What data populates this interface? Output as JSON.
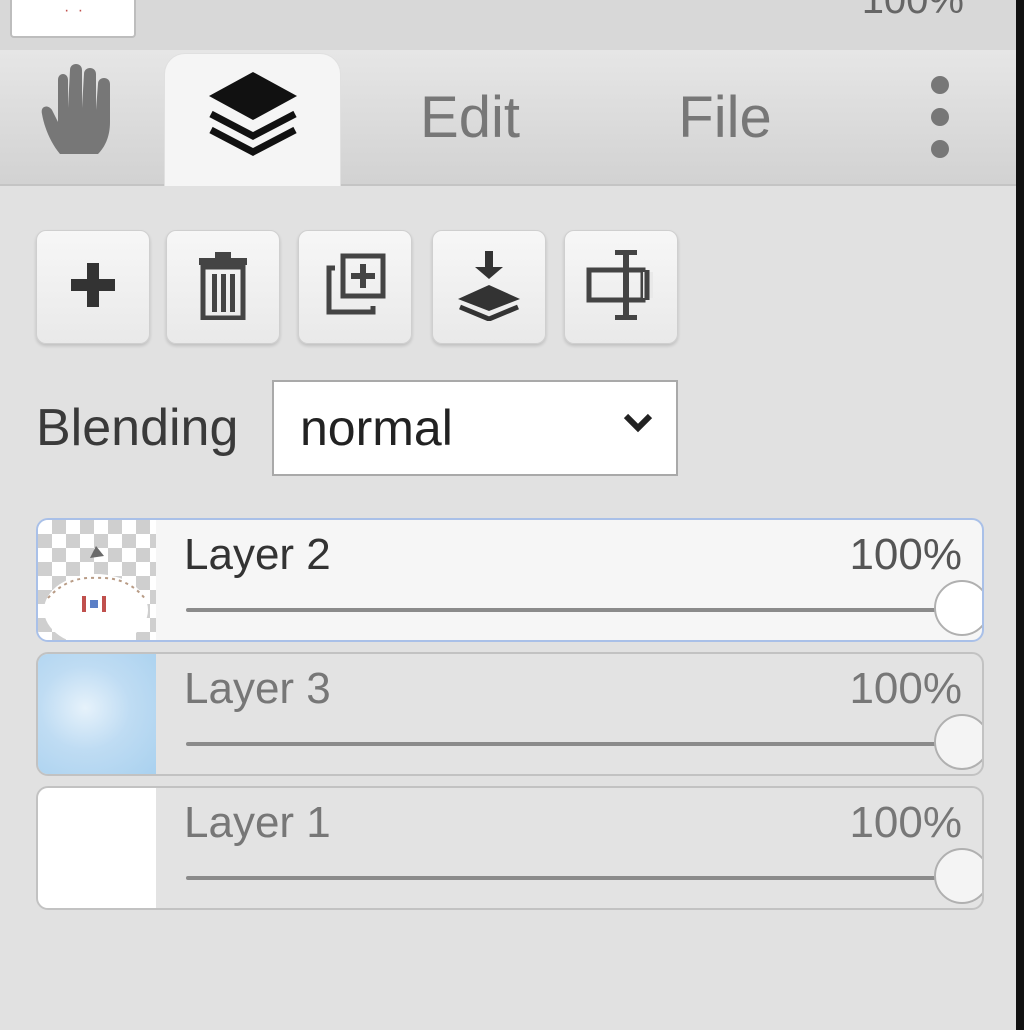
{
  "top": {
    "opacity_partial": "100%"
  },
  "tabs": {
    "hand_icon": "hand-icon",
    "layers_icon": "layers-icon",
    "edit": "Edit",
    "file": "File",
    "more_icon": "more-vertical-icon"
  },
  "toolbar": {
    "buttons": [
      {
        "icon": "add-icon"
      },
      {
        "icon": "trash-icon"
      },
      {
        "icon": "duplicate-icon"
      },
      {
        "icon": "merge-down-icon"
      },
      {
        "icon": "rename-icon"
      }
    ]
  },
  "blending": {
    "label": "Blending",
    "value": "normal"
  },
  "layers": [
    {
      "name": "Layer 2",
      "opacity": "100%",
      "opacity_value": 1.0,
      "active": true,
      "thumbnail": "transparent-with-drawing"
    },
    {
      "name": "Layer 3",
      "opacity": "100%",
      "opacity_value": 1.0,
      "active": false,
      "thumbnail": "sky"
    },
    {
      "name": "Layer 1",
      "opacity": "100%",
      "opacity_value": 1.0,
      "active": false,
      "thumbnail": "white"
    }
  ],
  "colors": {
    "active_border": "#a9c0e8",
    "panel_bg": "#e1e1e1"
  }
}
